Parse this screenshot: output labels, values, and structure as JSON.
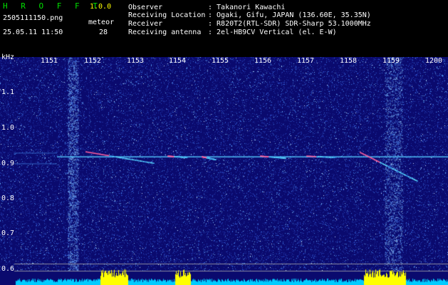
{
  "header": {
    "brand": "H R O F F T",
    "version": "1.0.0",
    "filename": "2505111150.png",
    "datetime": "25.05.11 11:50",
    "meteor_label": "meteor",
    "meteor_count": "28",
    "info": [
      {
        "label": "Observer",
        "value": ": Takanori Kawachi"
      },
      {
        "label": "Receiving Location",
        "value": ": Ogaki, Gifu, JAPAN (136.60E, 35.35N)"
      },
      {
        "label": "Receiver",
        "value": ": R820T2(RTL-SDR) SDR-Sharp 53.1000MHz"
      },
      {
        "label": "Receiving antenna",
        "value": ": 2el-HB9CV Vertical (el. E-W)"
      }
    ]
  },
  "chart_data": {
    "type": "heatmap",
    "ylabel": "kHz",
    "ylim": [
      0.6,
      1.2
    ],
    "y_ticks": [
      "1.1",
      "1.0",
      "0.9",
      "0.8",
      "0.7",
      "0.6"
    ],
    "x_ticks": [
      "1151",
      "1152",
      "1153",
      "1154",
      "1155",
      "1156",
      "1157",
      "1158",
      "1159",
      "1200"
    ],
    "carrier_khz": 0.925,
    "colors": {
      "background": "#0a0a6e",
      "carrier": "#55ccff",
      "echo": "#ff60a0",
      "level_fill": "#00ccff",
      "level_peak": "#ffff00",
      "label": "#ffffff"
    }
  }
}
